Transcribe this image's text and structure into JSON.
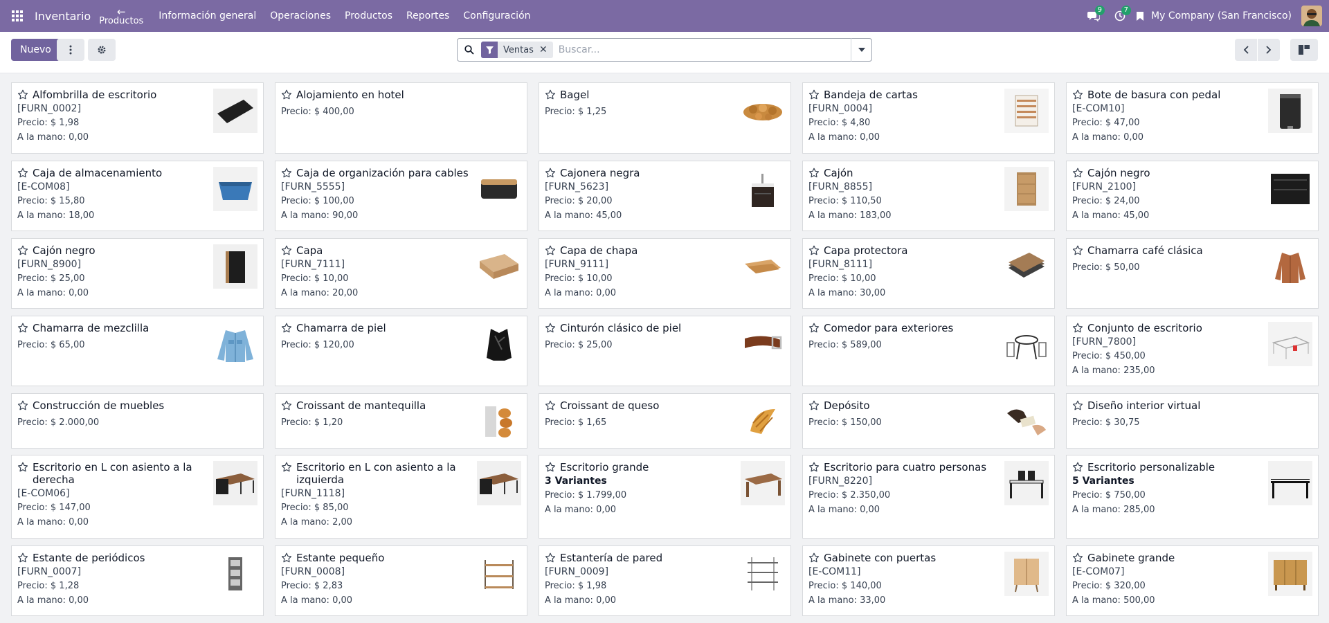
{
  "navbar": {
    "brand": "Inventario",
    "back_label": "Productos",
    "menu": [
      "Información general",
      "Operaciones",
      "Productos",
      "Reportes",
      "Configuración"
    ],
    "messages_count": "9",
    "activities_count": "7",
    "company": "My Company (San Francisco)"
  },
  "toolbar": {
    "new_label": "Nuevo",
    "facet_label": "Ventas",
    "search_placeholder": "Buscar..."
  },
  "colors": {
    "brand": "#7b6aa3",
    "primary": "#71639e",
    "badge": "#22a06b"
  },
  "products": [
    {
      "name": "Alfombrilla de escritorio",
      "code": "[FURN_0002]",
      "price": "Precio: $ 1,98",
      "onhand": "A la mano: 0,00",
      "image": "desk-pad"
    },
    {
      "name": "Alojamiento en hotel",
      "price": "Precio: $ 400,00"
    },
    {
      "name": "Bagel",
      "price": "Precio: $ 1,25",
      "image": "bagels"
    },
    {
      "name": "Bandeja de cartas",
      "code": "[FURN_0004]",
      "price": "Precio: $ 4,80",
      "onhand": "A la mano: 0,00",
      "image": "letter-tray"
    },
    {
      "name": "Bote de basura con pedal",
      "code": "[E-COM10]",
      "price": "Precio: $ 47,00",
      "onhand": "A la mano: 0,00",
      "image": "pedal-bin"
    },
    {
      "name": "Caja de almacenamiento",
      "code": "[E-COM08]",
      "price": "Precio: $ 15,80",
      "onhand": "A la mano: 18,00",
      "image": "storage-box"
    },
    {
      "name": "Caja de organización para cables",
      "code": "[FURN_5555]",
      "price": "Precio: $ 100,00",
      "onhand": "A la mano: 90,00",
      "image": "cable-box"
    },
    {
      "name": "Cajonera negra",
      "code": "[FURN_5623]",
      "price": "Precio: $ 20,00",
      "onhand": "A la mano: 45,00",
      "image": "black-cabinet"
    },
    {
      "name": "Cajón",
      "code": "[FURN_8855]",
      "price": "Precio: $ 110,50",
      "onhand": "A la mano: 183,00",
      "image": "wood-drawer"
    },
    {
      "name": "Cajón negro",
      "code": "[FURN_2100]",
      "price": "Precio: $ 24,00",
      "onhand": "A la mano: 45,00",
      "image": "black-drawer"
    },
    {
      "name": "Cajón negro",
      "code": "[FURN_8900]",
      "price": "Precio: $ 25,00",
      "onhand": "A la mano: 0,00",
      "image": "black-pedestal"
    },
    {
      "name": "Capa",
      "code": "[FURN_7111]",
      "price": "Precio: $ 10,00",
      "onhand": "A la mano: 20,00",
      "image": "plywood"
    },
    {
      "name": "Capa de chapa",
      "code": "[FURN_9111]",
      "price": "Precio: $ 10,00",
      "onhand": "A la mano: 0,00",
      "image": "veneer"
    },
    {
      "name": "Capa protectora",
      "code": "[FURN_8111]",
      "price": "Precio: $ 10,00",
      "onhand": "A la mano: 30,00",
      "image": "laminate"
    },
    {
      "name": "Chamarra café clásica",
      "price": "Precio: $ 50,00",
      "image": "brown-jacket"
    },
    {
      "name": "Chamarra de mezclilla",
      "price": "Precio: $ 65,00",
      "image": "denim-jacket"
    },
    {
      "name": "Chamarra de piel",
      "price": "Precio: $ 120,00",
      "image": "leather-jacket"
    },
    {
      "name": "Cinturón clásico de piel",
      "price": "Precio: $ 25,00",
      "image": "belt"
    },
    {
      "name": "Comedor para exteriores",
      "price": "Precio: $ 589,00",
      "image": "outdoor-dining"
    },
    {
      "name": "Conjunto de escritorio",
      "code": "[FURN_7800]",
      "price": "Precio: $ 450,00",
      "onhand": "A la mano: 235,00",
      "image": "desk-set"
    },
    {
      "name": "Construcción de muebles",
      "price": "Precio: $ 2.000,00"
    },
    {
      "name": "Croissant de mantequilla",
      "price": "Precio: $ 1,20",
      "image": "butter-croissants"
    },
    {
      "name": "Croissant de queso",
      "price": "Precio: $ 1,65",
      "image": "croissant"
    },
    {
      "name": "Depósito",
      "price": "Precio: $ 150,00",
      "image": "deposit"
    },
    {
      "name": "Diseño interior virtual",
      "price": "Precio: $ 30,75"
    },
    {
      "name": "Escritorio en L con asiento a la derecha",
      "code": "[E-COM06]",
      "price": "Precio: $ 147,00",
      "onhand": "A la mano: 0,00",
      "image": "l-desk"
    },
    {
      "name": "Escritorio en L con asiento a la izquierda",
      "code": "[FURN_1118]",
      "price": "Precio: $ 85,00",
      "onhand": "A la mano: 2,00",
      "image": "l-desk"
    },
    {
      "name": "Escritorio grande",
      "variants": "3 Variantes",
      "price": "Precio: $ 1.799,00",
      "onhand": "A la mano: 0,00",
      "image": "large-desk"
    },
    {
      "name": "Escritorio para cuatro personas",
      "code": "[FURN_8220]",
      "price": "Precio: $ 2.350,00",
      "onhand": "A la mano: 0,00",
      "image": "four-person-desk"
    },
    {
      "name": "Escritorio personalizable",
      "variants": "5 Variantes",
      "price": "Precio: $ 750,00",
      "onhand": "A la mano: 285,00",
      "image": "custom-desk"
    },
    {
      "name": "Estante de periódicos",
      "code": "[FURN_0007]",
      "price": "Precio: $ 1,28",
      "onhand": "A la mano: 0,00",
      "image": "magazine-rack"
    },
    {
      "name": "Estante pequeño",
      "code": "[FURN_0008]",
      "price": "Precio: $ 2,83",
      "onhand": "A la mano: 0,00",
      "image": "small-shelf"
    },
    {
      "name": "Estantería de pared",
      "code": "[FURN_0009]",
      "price": "Precio: $ 1,98",
      "onhand": "A la mano: 0,00",
      "image": "wall-shelf"
    },
    {
      "name": "Gabinete con puertas",
      "code": "[E-COM11]",
      "price": "Precio: $ 140,00",
      "onhand": "A la mano: 33,00",
      "image": "cabinet-doors"
    },
    {
      "name": "Gabinete grande",
      "code": "[E-COM07]",
      "price": "Precio: $ 320,00",
      "onhand": "A la mano: 500,00",
      "image": "large-cabinet"
    }
  ]
}
